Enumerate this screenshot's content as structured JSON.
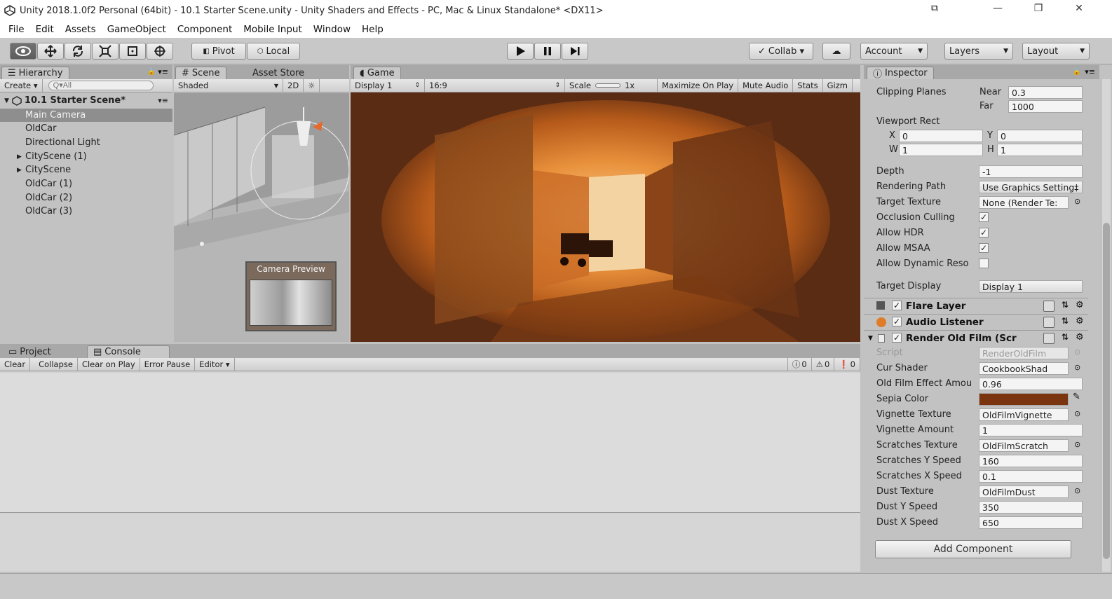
{
  "window": {
    "title": "Unity 2018.1.0f2 Personal (64bit) - 10.1 Starter Scene.unity - Unity Shaders and Effects - PC, Mac & Linux Standalone* <DX11>"
  },
  "menu": [
    "File",
    "Edit",
    "Assets",
    "GameObject",
    "Component",
    "Mobile Input",
    "Window",
    "Help"
  ],
  "toolbar": {
    "pivot": "Pivot",
    "local": "Local",
    "collab": "Collab ▾",
    "account": "Account",
    "layers": "Layers",
    "layout": "Layout"
  },
  "hierarchy": {
    "tab": "Hierarchy",
    "create": "Create ▾",
    "search_placeholder": "Q▾All",
    "scene": "10.1 Starter Scene*",
    "items": [
      {
        "label": "Main Camera",
        "selected": true
      },
      {
        "label": "OldCar"
      },
      {
        "label": "Directional Light"
      },
      {
        "label": "CityScene (1)",
        "expandable": true
      },
      {
        "label": "CityScene",
        "expandable": true
      },
      {
        "label": "OldCar (1)"
      },
      {
        "label": "OldCar (2)"
      },
      {
        "label": "OldCar (3)"
      }
    ]
  },
  "scene": {
    "tab": "Scene",
    "tab2": "Asset Store",
    "shaded": "Shaded",
    "mode2d": "2D",
    "camera_preview": "Camera Preview"
  },
  "game": {
    "tab": "Game",
    "display": "Display 1",
    "aspect": "16:9",
    "scale_label": "Scale",
    "scale_value": "1x",
    "maximize": "Maximize On Play",
    "mute": "Mute Audio",
    "stats": "Stats",
    "gizmos": "Gizm"
  },
  "console": {
    "tab_project": "Project",
    "tab_console": "Console",
    "buttons": [
      "Clear",
      "Collapse",
      "Clear on Play",
      "Error Pause",
      "Editor ▾"
    ],
    "counts": [
      "0",
      "0",
      "0"
    ]
  },
  "inspector": {
    "tab": "Inspector",
    "clipping_label": "Clipping Planes",
    "near_label": "Near",
    "near": "0.3",
    "far_label": "Far",
    "far": "1000",
    "viewport_label": "Viewport Rect",
    "x_label": "X",
    "x": "0",
    "y_label": "Y",
    "y": "0",
    "w_label": "W",
    "w": "1",
    "h_label": "H",
    "h": "1",
    "depth_label": "Depth",
    "depth": "-1",
    "rendering_path_label": "Rendering Path",
    "rendering_path": "Use Graphics Setting‡",
    "target_texture_label": "Target Texture",
    "target_texture": "None (Render Te:",
    "occlusion_label": "Occlusion Culling",
    "hdr_label": "Allow HDR",
    "msaa_label": "Allow MSAA",
    "dynres_label": "Allow Dynamic Reso",
    "target_display_label": "Target Display",
    "target_display": "Display 1",
    "flare": "Flare Layer",
    "audio": "Audio Listener",
    "oldfilm": "Render Old Film (Scr",
    "props": [
      {
        "label": "Script",
        "value": "RenderOldFilm",
        "disabled": true
      },
      {
        "label": "Cur Shader",
        "value": "CookbookShad"
      },
      {
        "label": "Old Film Effect Amou",
        "value": "0.96"
      },
      {
        "label": "Sepia Color",
        "value": ""
      },
      {
        "label": "Vignette Texture",
        "value": "OldFilmVignette"
      },
      {
        "label": "Vignette Amount",
        "value": "1"
      },
      {
        "label": "Scratches Texture",
        "value": "OldFilmScratch"
      },
      {
        "label": "Scratches Y Speed",
        "value": "160"
      },
      {
        "label": "Scratches X Speed",
        "value": "0.1"
      },
      {
        "label": "Dust Texture",
        "value": "OldFilmDust"
      },
      {
        "label": "Dust Y Speed",
        "value": "350"
      },
      {
        "label": "Dust X Speed",
        "value": "650"
      }
    ],
    "add_component": "Add Component"
  },
  "colors": {
    "sepia": "#7a3410",
    "selection": "#8e8e8e",
    "panel": "#c2c2c2",
    "tab_strip": "#a8a8a8"
  }
}
